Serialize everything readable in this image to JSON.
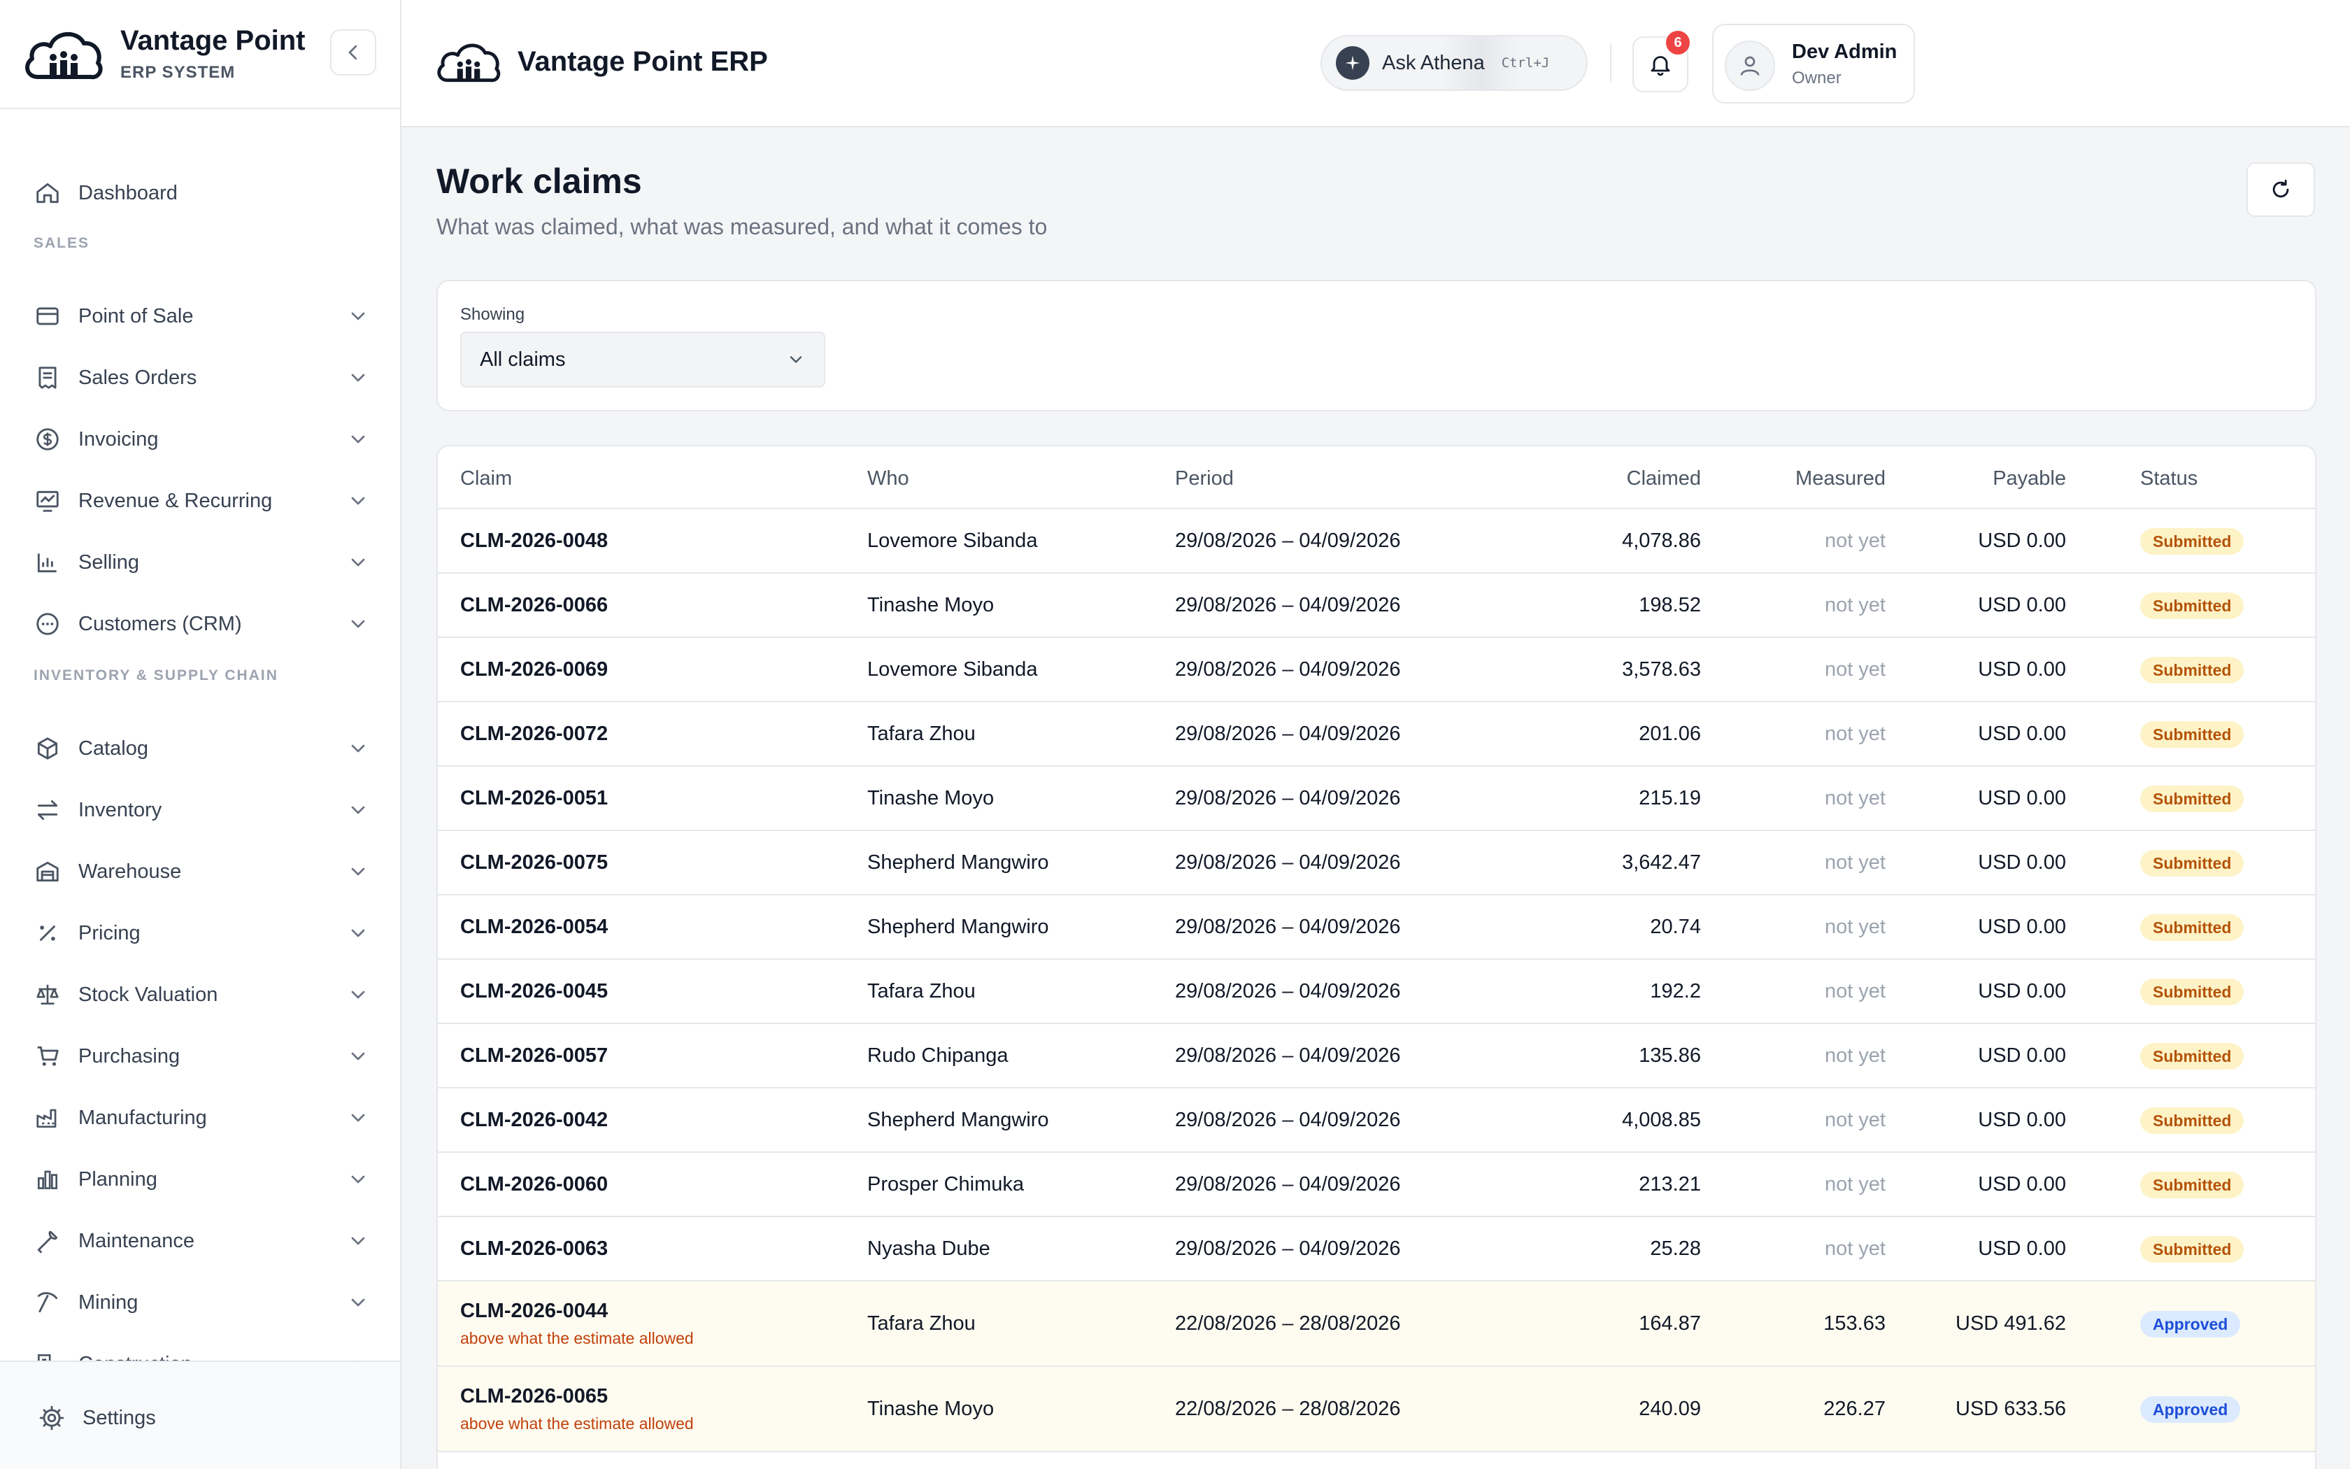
{
  "brand": {
    "name": "Vantage Point",
    "subtitle": "ERP SYSTEM"
  },
  "header": {
    "title": "Vantage Point ERP",
    "ask_label": "Ask Athena",
    "ask_shortcut": "Ctrl+J",
    "notifications_count": "6",
    "user_name": "Dev Admin",
    "user_role": "Owner"
  },
  "sidebar": {
    "dashboard": "Dashboard",
    "section_sales": "SALES",
    "sales_items": [
      "Point of Sale",
      "Sales Orders",
      "Invoicing",
      "Revenue & Recurring",
      "Selling",
      "Customers (CRM)"
    ],
    "section_inventory": "INVENTORY & SUPPLY CHAIN",
    "inventory_items": [
      "Catalog",
      "Inventory",
      "Warehouse",
      "Pricing",
      "Stock Valuation",
      "Purchasing",
      "Manufacturing",
      "Planning",
      "Maintenance",
      "Mining",
      "Construction"
    ],
    "settings": "Settings"
  },
  "page": {
    "title": "Work claims",
    "subtitle": "What was claimed, what was measured, and what it comes to"
  },
  "filter": {
    "label": "Showing",
    "value": "All claims"
  },
  "table": {
    "columns": [
      "Claim",
      "Who",
      "Period",
      "Claimed",
      "Measured",
      "Payable",
      "Status"
    ],
    "rows": [
      {
        "claim": "CLM-2026-0048",
        "who": "Lovemore Sibanda",
        "period": "29/08/2026 – 04/09/2026",
        "claimed": "4,078.86",
        "measured": "not yet",
        "payable": "USD 0.00",
        "status": "Submitted"
      },
      {
        "claim": "CLM-2026-0066",
        "who": "Tinashe Moyo",
        "period": "29/08/2026 – 04/09/2026",
        "claimed": "198.52",
        "measured": "not yet",
        "payable": "USD 0.00",
        "status": "Submitted"
      },
      {
        "claim": "CLM-2026-0069",
        "who": "Lovemore Sibanda",
        "period": "29/08/2026 – 04/09/2026",
        "claimed": "3,578.63",
        "measured": "not yet",
        "payable": "USD 0.00",
        "status": "Submitted"
      },
      {
        "claim": "CLM-2026-0072",
        "who": "Tafara Zhou",
        "period": "29/08/2026 – 04/09/2026",
        "claimed": "201.06",
        "measured": "not yet",
        "payable": "USD 0.00",
        "status": "Submitted"
      },
      {
        "claim": "CLM-2026-0051",
        "who": "Tinashe Moyo",
        "period": "29/08/2026 – 04/09/2026",
        "claimed": "215.19",
        "measured": "not yet",
        "payable": "USD 0.00",
        "status": "Submitted"
      },
      {
        "claim": "CLM-2026-0075",
        "who": "Shepherd Mangwiro",
        "period": "29/08/2026 – 04/09/2026",
        "claimed": "3,642.47",
        "measured": "not yet",
        "payable": "USD 0.00",
        "status": "Submitted"
      },
      {
        "claim": "CLM-2026-0054",
        "who": "Shepherd Mangwiro",
        "period": "29/08/2026 – 04/09/2026",
        "claimed": "20.74",
        "measured": "not yet",
        "payable": "USD 0.00",
        "status": "Submitted"
      },
      {
        "claim": "CLM-2026-0045",
        "who": "Tafara Zhou",
        "period": "29/08/2026 – 04/09/2026",
        "claimed": "192.2",
        "measured": "not yet",
        "payable": "USD 0.00",
        "status": "Submitted"
      },
      {
        "claim": "CLM-2026-0057",
        "who": "Rudo Chipanga",
        "period": "29/08/2026 – 04/09/2026",
        "claimed": "135.86",
        "measured": "not yet",
        "payable": "USD 0.00",
        "status": "Submitted"
      },
      {
        "claim": "CLM-2026-0042",
        "who": "Shepherd Mangwiro",
        "period": "29/08/2026 – 04/09/2026",
        "claimed": "4,008.85",
        "measured": "not yet",
        "payable": "USD 0.00",
        "status": "Submitted"
      },
      {
        "claim": "CLM-2026-0060",
        "who": "Prosper Chimuka",
        "period": "29/08/2026 – 04/09/2026",
        "claimed": "213.21",
        "measured": "not yet",
        "payable": "USD 0.00",
        "status": "Submitted"
      },
      {
        "claim": "CLM-2026-0063",
        "who": "Nyasha Dube",
        "period": "29/08/2026 – 04/09/2026",
        "claimed": "25.28",
        "measured": "not yet",
        "payable": "USD 0.00",
        "status": "Submitted"
      },
      {
        "claim": "CLM-2026-0044",
        "note": "above what the estimate allowed",
        "who": "Tafara Zhou",
        "period": "22/08/2026 – 28/08/2026",
        "claimed": "164.87",
        "measured": "153.63",
        "payable": "USD 491.62",
        "status": "Approved"
      },
      {
        "claim": "CLM-2026-0065",
        "note": "above what the estimate allowed",
        "who": "Tinashe Moyo",
        "period": "22/08/2026 – 28/08/2026",
        "claimed": "240.09",
        "measured": "226.27",
        "payable": "USD 633.56",
        "status": "Approved"
      }
    ]
  }
}
